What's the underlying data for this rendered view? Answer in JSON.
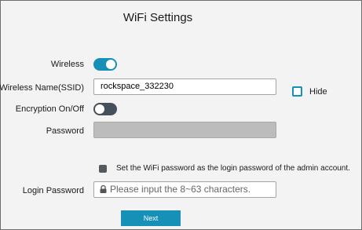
{
  "page": {
    "title": "WiFi Settings"
  },
  "form": {
    "wireless": {
      "label": "Wireless",
      "state": "on"
    },
    "ssid": {
      "label": "Wireless Name(SSID)",
      "value": "rockspace_332230",
      "hide_label": "Hide",
      "hide_checked": false
    },
    "encryption": {
      "label": "Encryption On/Off",
      "state": "off"
    },
    "password": {
      "label": "Password",
      "value": "",
      "disabled": true
    },
    "admin_option": {
      "text": "Set the WiFi password as the login password of the admin account.",
      "checked": true
    },
    "login_password": {
      "label": "Login Password",
      "placeholder": "Please input the 8~63 characters."
    },
    "next_button": {
      "label": "Next"
    }
  },
  "colors": {
    "accent": "#1790b7",
    "toggle_off": "#46505c",
    "disabled_field": "#bcbcbc",
    "background": "#f3f3f3"
  },
  "icons": {
    "login_field": "lock-icon"
  }
}
